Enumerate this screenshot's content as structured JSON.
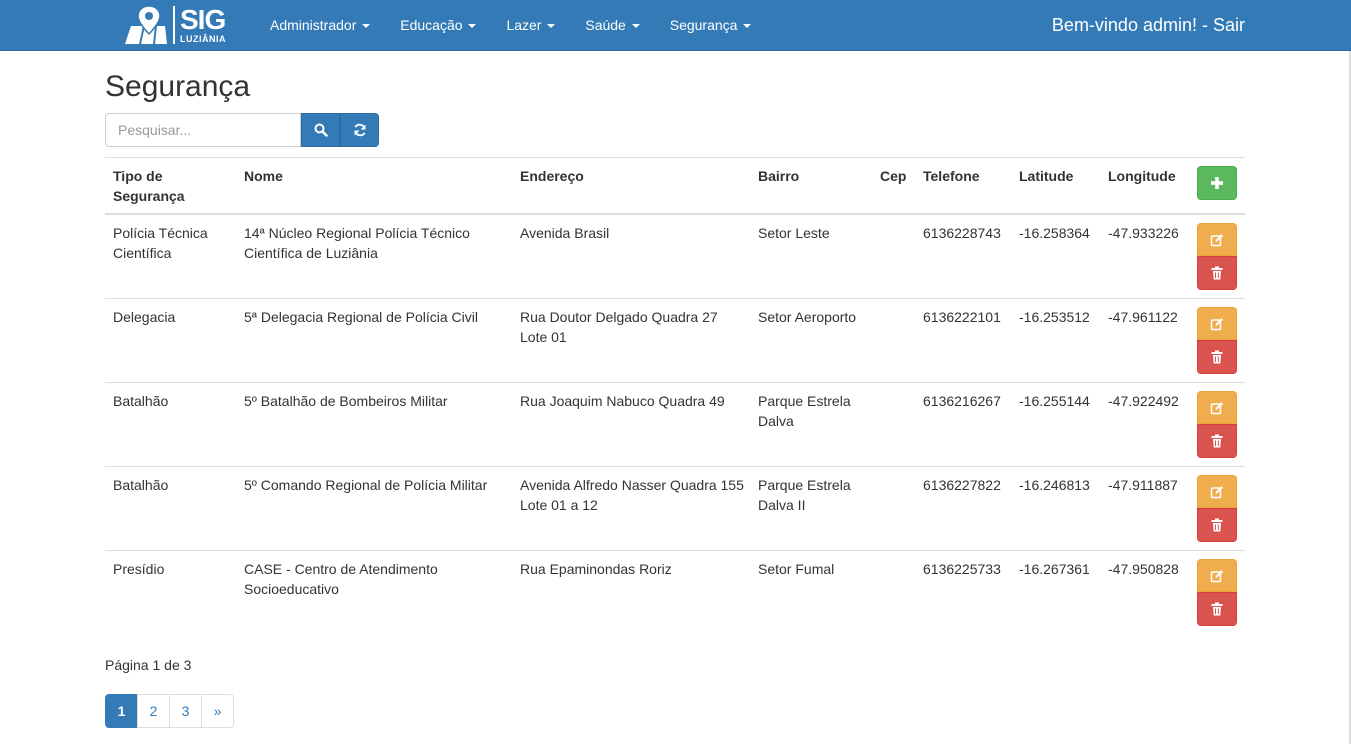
{
  "brand": {
    "name": "SIG",
    "city": "LUZIÂNIA"
  },
  "nav": {
    "menus": [
      {
        "label": "Administrador"
      },
      {
        "label": "Educação"
      },
      {
        "label": "Lazer"
      },
      {
        "label": "Saúde"
      },
      {
        "label": "Segurança"
      }
    ],
    "welcome": "Bem-vindo admin! - Sair"
  },
  "page": {
    "title": "Segurança"
  },
  "search": {
    "placeholder": "Pesquisar..."
  },
  "table": {
    "headers": {
      "tipo": "Tipo de Segurança",
      "nome": "Nome",
      "endereco": "Endereço",
      "bairro": "Bairro",
      "cep": "Cep",
      "telefone": "Telefone",
      "latitude": "Latitude",
      "longitude": "Longitude"
    },
    "rows": [
      {
        "tipo": "Polícia Técnica Científica",
        "nome": "14ª Núcleo Regional Polícia Técnico Científica de Luziânia",
        "endereco": "Avenida Brasil",
        "bairro": "Setor Leste",
        "cep": "",
        "telefone": "6136228743",
        "latitude": "-16.258364",
        "longitude": "-47.933226"
      },
      {
        "tipo": "Delegacia",
        "nome": "5ª Delegacia Regional de Polícia Civil",
        "endereco": "Rua Doutor Delgado Quadra 27 Lote 01",
        "bairro": "Setor Aeroporto",
        "cep": "",
        "telefone": "6136222101",
        "latitude": "-16.253512",
        "longitude": "-47.961122"
      },
      {
        "tipo": "Batalhão",
        "nome": "5º Batalhão de Bombeiros Militar",
        "endereco": "Rua Joaquim Nabuco Quadra 49",
        "bairro": "Parque Estrela Dalva",
        "cep": "",
        "telefone": "6136216267",
        "latitude": "-16.255144",
        "longitude": "-47.922492"
      },
      {
        "tipo": "Batalhão",
        "nome": "5º Comando Regional de Polícia Militar",
        "endereco": "Avenida Alfredo Nasser Quadra 155 Lote 01 a 12",
        "bairro": "Parque Estrela Dalva II",
        "cep": "",
        "telefone": "6136227822",
        "latitude": "-16.246813",
        "longitude": "-47.911887"
      },
      {
        "tipo": "Presídio",
        "nome": "CASE - Centro de Atendimento Socioeducativo",
        "endereco": "Rua Epaminondas Roriz",
        "bairro": "Setor Fumal",
        "cep": "",
        "telefone": "6136225733",
        "latitude": "-16.267361",
        "longitude": "-47.950828"
      }
    ]
  },
  "pagination": {
    "info": "Página 1 de 3",
    "pages": [
      "1",
      "2",
      "3",
      "»"
    ],
    "current": "1"
  },
  "icons": {
    "search": "search-icon",
    "refresh": "refresh-icon",
    "add": "plus-icon",
    "edit": "edit-icon",
    "delete": "trash-icon"
  },
  "colors": {
    "navbar": "#337ab7",
    "add": "#5cb85c",
    "edit": "#f0ad4e",
    "delete": "#d9534f"
  }
}
